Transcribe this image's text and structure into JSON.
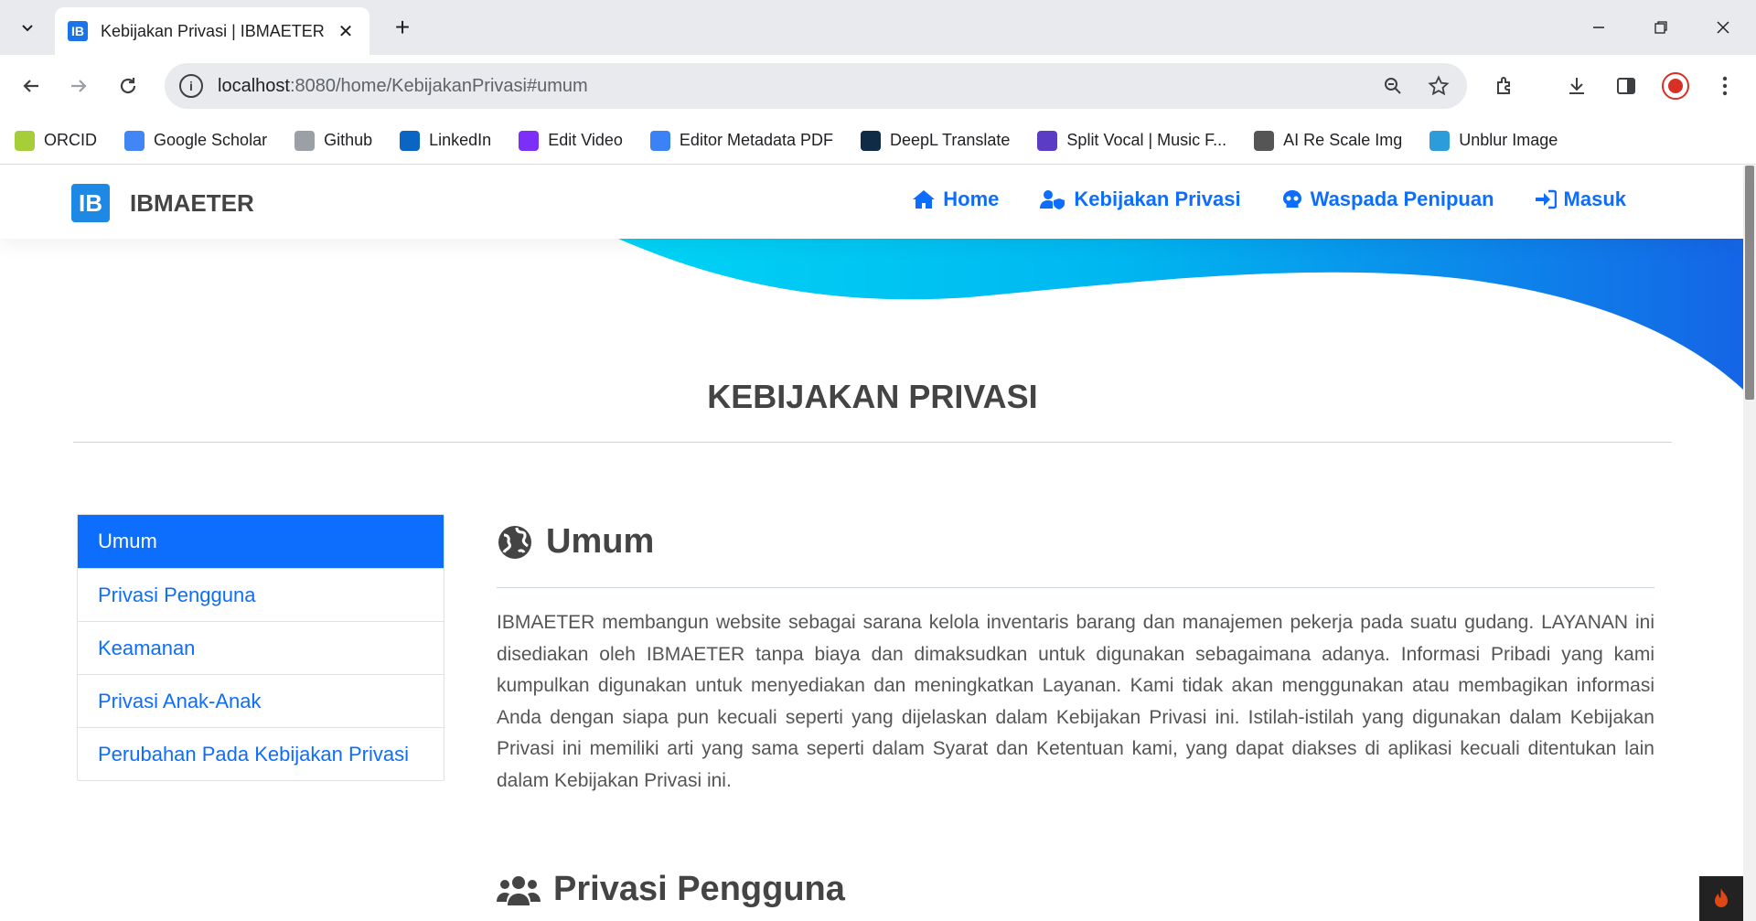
{
  "browser": {
    "tab_title": "Kebijakan Privasi | IBMAETER",
    "tab_favicon": "IB",
    "url_host": "localhost",
    "url_rest": ":8080/home/KebijakanPrivasi#umum",
    "bookmarks": [
      {
        "label": "ORCID",
        "icon": "orcid-icon",
        "color": "#a6ce39"
      },
      {
        "label": "Google Scholar",
        "icon": "google-scholar-icon",
        "color": "#4285f4"
      },
      {
        "label": "Github",
        "icon": "github-icon",
        "color": "#9aa0a6"
      },
      {
        "label": "LinkedIn",
        "icon": "linkedin-icon",
        "color": "#0a66c2"
      },
      {
        "label": "Edit Video",
        "icon": "edit-video-icon",
        "color": "#7b2ff7"
      },
      {
        "label": "Editor Metadata PDF",
        "icon": "editor-metadata-icon",
        "color": "#3b82f6"
      },
      {
        "label": "DeepL Translate",
        "icon": "deepl-icon",
        "color": "#0f2b46"
      },
      {
        "label": "Split Vocal | Music F...",
        "icon": "split-vocal-icon",
        "color": "#5b3cc4"
      },
      {
        "label": "AI Re Scale Img",
        "icon": "ai-rescale-icon",
        "color": "#555555"
      },
      {
        "label": "Unblur Image",
        "icon": "unblur-icon",
        "color": "#2d9cdb"
      }
    ]
  },
  "site": {
    "brand_logo": "IB",
    "brand_name": "IBMAETER",
    "nav": [
      {
        "label": "Home",
        "icon": "home-icon"
      },
      {
        "label": "Kebijakan Privasi",
        "icon": "user-shield-icon"
      },
      {
        "label": "Waspada Penipuan",
        "icon": "skull-icon"
      },
      {
        "label": "Masuk",
        "icon": "sign-in-icon"
      }
    ],
    "page_title": "KEBIJAKAN PRIVASI",
    "sidebar": [
      {
        "label": "Umum",
        "active": true
      },
      {
        "label": "Privasi Pengguna",
        "active": false
      },
      {
        "label": "Keamanan",
        "active": false
      },
      {
        "label": "Privasi Anak-Anak",
        "active": false
      },
      {
        "label": "Perubahan Pada Kebijakan Privasi",
        "active": false
      }
    ],
    "sections": [
      {
        "title": "Umum",
        "icon": "globe-icon",
        "body": "IBMAETER membangun website sebagai sarana kelola inventaris barang dan manajemen pekerja pada suatu gudang. LAYANAN ini disediakan oleh IBMAETER tanpa biaya dan dimaksudkan untuk digunakan sebagaimana adanya. Informasi Pribadi yang kami kumpulkan digunakan untuk menyediakan dan meningkatkan Layanan. Kami tidak akan menggunakan atau membagikan informasi Anda dengan siapa pun kecuali seperti yang dijelaskan dalam Kebijakan Privasi ini. Istilah-istilah yang digunakan dalam Kebijakan Privasi ini memiliki arti yang sama seperti dalam Syarat dan Ketentuan kami, yang dapat diakses di aplikasi kecuali ditentukan lain dalam Kebijakan Privasi ini."
      },
      {
        "title": "Privasi Pengguna",
        "icon": "users-icon"
      }
    ],
    "accent_color": "#0d6efd"
  }
}
